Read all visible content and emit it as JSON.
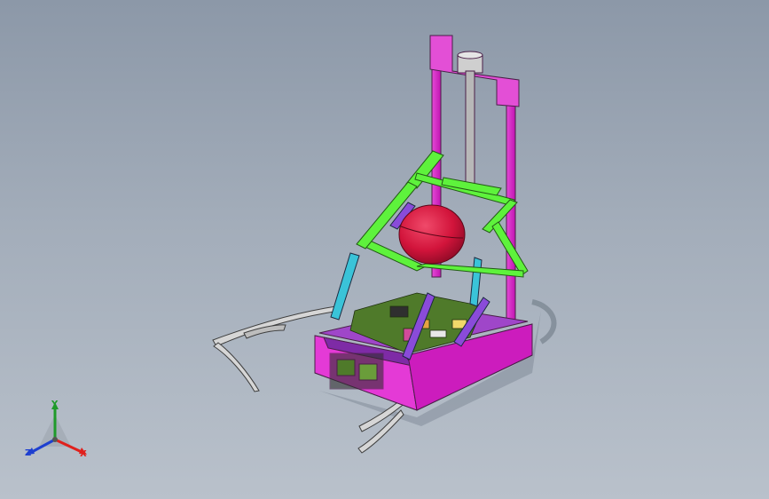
{
  "viewport": {
    "background_top": "#8c98a8",
    "background_bottom": "#b9c1cb"
  },
  "model": {
    "colors": {
      "chassis": "#d21ec3",
      "chassis_top": "#9f46c9",
      "frame": "#5ef23c",
      "ball": "#d2143b",
      "struts": "#3ac3d8",
      "purple_struts": "#8a4bd9",
      "board": "#4f7a2a",
      "arms": "#c9c9c9",
      "column": "#e06ad8"
    }
  },
  "triad": {
    "x_label": "X",
    "y_label": "Y",
    "z_label": "Z",
    "x_color": "#e0201c",
    "y_color": "#1f9a2a",
    "z_color": "#1d3fd0"
  }
}
